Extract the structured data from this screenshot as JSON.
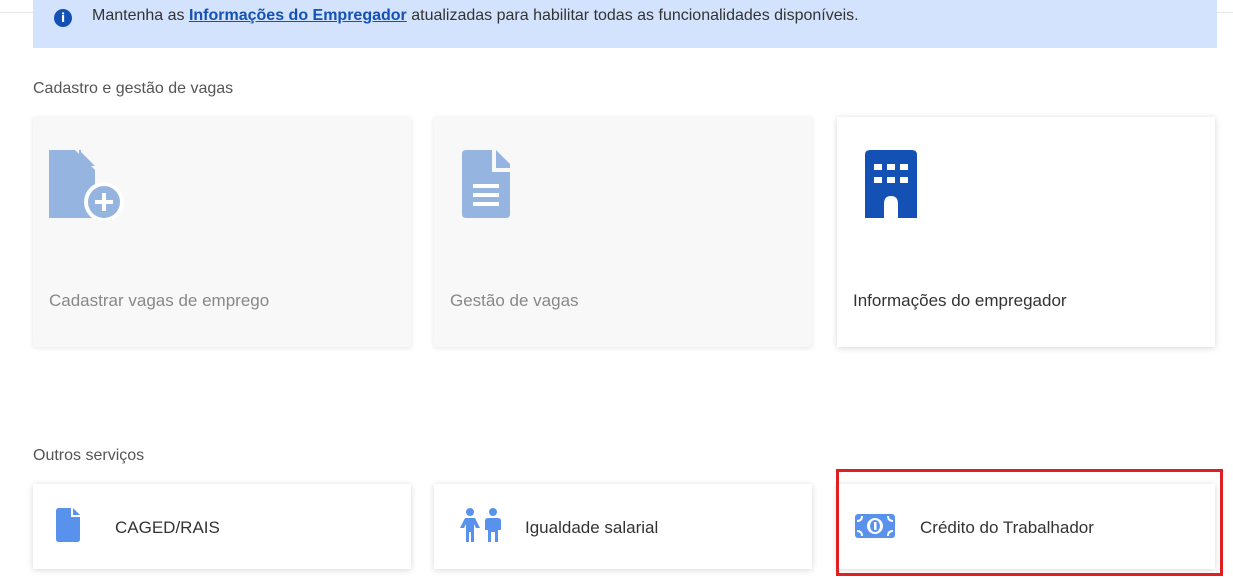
{
  "banner": {
    "text_before": "Mantenha as ",
    "link_text": "Informações do Empregador",
    "text_after": " atualizadas para habilitar todas as funcionalidades disponíveis.",
    "icon": "info-icon"
  },
  "sections": {
    "vagas_title": "Cadastro e gestão de vagas",
    "outros_title": "Outros serviços"
  },
  "cards": [
    {
      "label": "Cadastrar vagas de emprego",
      "icon": "file-add-icon",
      "enabled": false
    },
    {
      "label": "Gestão de vagas",
      "icon": "document-icon",
      "enabled": false
    },
    {
      "label": "Informações do empregador",
      "icon": "building-icon",
      "enabled": true
    }
  ],
  "services": [
    {
      "label": "CAGED/RAIS",
      "icon": "file-icon"
    },
    {
      "label": "Igualdade salarial",
      "icon": "man-woman-icon"
    },
    {
      "label": "Crédito do Trabalhador",
      "icon": "money-bill-icon"
    }
  ],
  "colors": {
    "primary": "#1351b4",
    "icon_blue": "#5992ed",
    "icon_muted": "#96b4e0",
    "banner_bg": "#d4e3fd",
    "highlight": "#e02020"
  }
}
